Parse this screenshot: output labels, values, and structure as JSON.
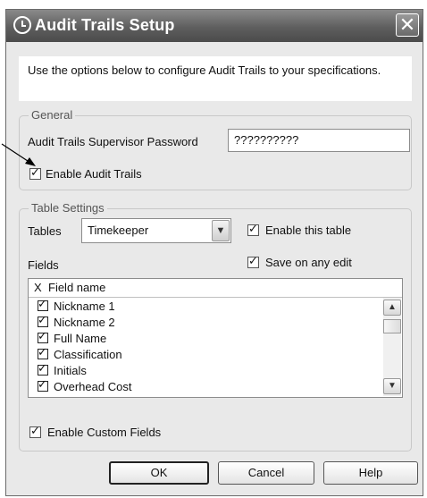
{
  "dialog": {
    "title": "Audit Trails Setup",
    "close_glyph": "✕",
    "intro": "Use the options below to configure Audit Trails to your specifications."
  },
  "general": {
    "legend": "General",
    "password_label": "Audit Trails Supervisor Password",
    "password_value": "??????????",
    "enable_audit_trails": "Enable Audit Trails"
  },
  "table_settings": {
    "legend": "Table Settings",
    "tables_label": "Tables",
    "tables_value": "Timekeeper",
    "enable_this_table": "Enable this table",
    "save_on_any_edit": "Save on any edit",
    "fields_label": "Fields",
    "list_header_x": "X",
    "list_header_name": "Field name",
    "fields": [
      {
        "name": "Nickname 1",
        "checked": true
      },
      {
        "name": "Nickname 2",
        "checked": true
      },
      {
        "name": "Full Name",
        "checked": true
      },
      {
        "name": "Classification",
        "checked": true
      },
      {
        "name": "Initials",
        "checked": true
      },
      {
        "name": "Overhead Cost",
        "checked": true
      }
    ],
    "enable_custom_fields": "Enable Custom Fields"
  },
  "buttons": {
    "ok": "OK",
    "cancel": "Cancel",
    "help": "Help"
  },
  "colors": {
    "titlebar": "#5e5e5e",
    "dialog_bg": "#e9e9e9"
  }
}
